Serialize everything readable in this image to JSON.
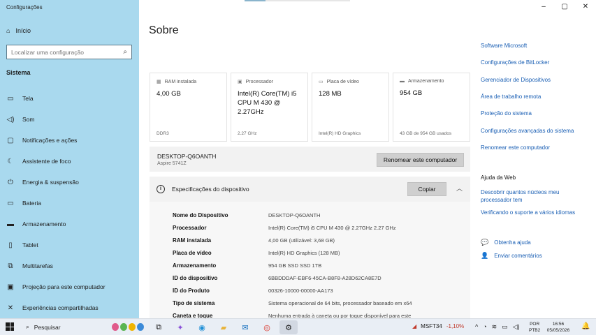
{
  "app_title": "Configurações",
  "window_controls": {
    "minimize": "–",
    "maximize": "▢",
    "close": "✕"
  },
  "sidebar": {
    "home": "Início",
    "search_placeholder": "Localizar uma configuração",
    "section": "Sistema",
    "items": [
      {
        "label": "Tela",
        "icon": "monitor-icon",
        "glyph": "▭"
      },
      {
        "label": "Som",
        "icon": "speaker-icon",
        "glyph": "🔈"
      },
      {
        "label": "Notificações e ações",
        "icon": "notification-icon",
        "glyph": "▢"
      },
      {
        "label": "Assistente de foco",
        "icon": "moon-icon",
        "glyph": "☾"
      },
      {
        "label": "Energia & suspensão",
        "icon": "power-icon",
        "glyph": "⏻"
      },
      {
        "label": "Bateria",
        "icon": "battery-icon",
        "glyph": "▭"
      },
      {
        "label": "Armazenamento",
        "icon": "storage-icon",
        "glyph": "▬"
      },
      {
        "label": "Tablet",
        "icon": "tablet-icon",
        "glyph": "▯"
      },
      {
        "label": "Multitarefas",
        "icon": "multitask-icon",
        "glyph": "⧉"
      },
      {
        "label": "Projeção para este computador",
        "icon": "projection-icon",
        "glyph": "▣"
      },
      {
        "label": "Experiências compartilhadas",
        "icon": "shared-icon",
        "glyph": "✕"
      }
    ]
  },
  "main": {
    "title": "Sobre",
    "cards": [
      {
        "caption": "RAM instalada",
        "value": "4,00 GB",
        "sub": "DDR3"
      },
      {
        "caption": "Processador",
        "value": "Intel(R) Core(TM) i5 CPU      M 430  @ 2.27GHz",
        "sub": "2.27 GHz"
      },
      {
        "caption": "Placa de vídeo",
        "value": "128 MB",
        "sub": "Intel(R) HD Graphics"
      },
      {
        "caption": "Armazenamento",
        "value": "954 GB",
        "sub": "43 GB de 954 GB usados"
      }
    ],
    "pc_name": "DESKTOP-Q6OANTH",
    "pc_model": "Aspire 5741Z",
    "rename_button": "Renomear este computador",
    "specs_title": "Especificações do dispositivo",
    "copy_button": "Copiar",
    "specs": [
      {
        "k": "Nome do Dispositivo",
        "v": "DESKTOP-Q6OANTH"
      },
      {
        "k": "Processador",
        "v": "Intel(R) Core(TM) i5 CPU       M 430  @ 2.27GHz   2.27 GHz"
      },
      {
        "k": "RAM instalada",
        "v": "4,00 GB (utilizável: 3,68 GB)"
      },
      {
        "k": "Placa de vídeo",
        "v": "Intel(R) HD Graphics (128 MB)"
      },
      {
        "k": "Armazenamento",
        "v": "954 GB SSD SSD 1TB"
      },
      {
        "k": "ID do dispositivo",
        "v": "6BBDDDAF-EBF6-45CA-B8F8-A28D62CA8E7D"
      },
      {
        "k": "ID do Produto",
        "v": "00326-10000-00000-AA173"
      },
      {
        "k": "Tipo de sistema",
        "v": "Sistema operacional de 64 bits, processador baseado em x64"
      },
      {
        "k": "Caneta e toque",
        "v": "Nenhuma entrada à caneta ou por toque disponível para este"
      }
    ]
  },
  "related": {
    "links": [
      "Software Microsoft",
      "Configurações de BitLocker",
      "Gerenciador de Dispositivos",
      "Área de trabalho remota",
      "Proteção do sistema",
      "Configurações avançadas do sistema",
      "Renomear este computador"
    ],
    "help_title": "Ajuda da Web",
    "help_links": [
      "Descobrir quantos núcleos meu processador tem",
      "Verificando o suporte a vários idiomas"
    ],
    "get_help": "Obtenha ajuda",
    "feedback": "Enviar comentários"
  },
  "taskbar": {
    "search": "Pesquisar",
    "stock_symbol": "MSFT34",
    "stock_change": "-1,10%",
    "lang_1": "POR",
    "lang_2": "PTB2",
    "time": "16:56",
    "date": "05/05/2026"
  },
  "colors": {
    "sidebar": "#a9d9ee",
    "link": "#1a5fb4",
    "stock_down": "#c0392b"
  }
}
